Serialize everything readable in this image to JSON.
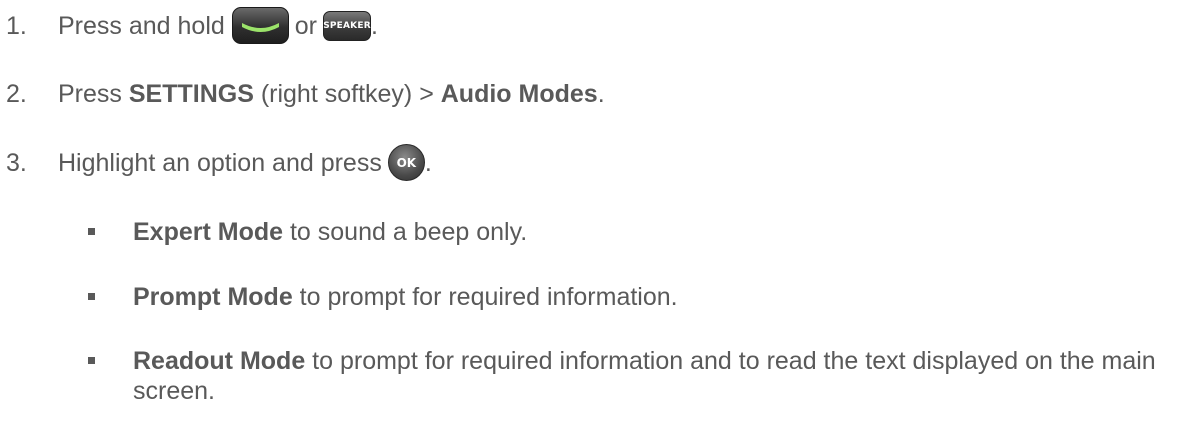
{
  "steps": [
    {
      "number": "1.",
      "text_before": "Press and hold",
      "talk_key_icon": "green-talk-key-icon",
      "connector": "or",
      "speaker_key_label": "SPEAKER",
      "text_after": "."
    },
    {
      "number": "2.",
      "text_before": "Press ",
      "bold1": "SETTINGS",
      "middle": " (right softkey) > ",
      "bold2": "Audio Modes",
      "text_after": "."
    },
    {
      "number": "3.",
      "text_before": "Highlight an option and press",
      "ok_key_label": "OK",
      "text_after": "."
    }
  ],
  "options": [
    {
      "bold": "Expert Mode",
      "text": " to sound a beep only."
    },
    {
      "bold": "Prompt Mode",
      "text": " to prompt for required information."
    },
    {
      "bold": "Readout Mode",
      "text": " to prompt for required information and to read the text displayed on the main screen."
    }
  ],
  "colors": {
    "text": "#595959",
    "talk_key_accent": "#9be36a"
  }
}
